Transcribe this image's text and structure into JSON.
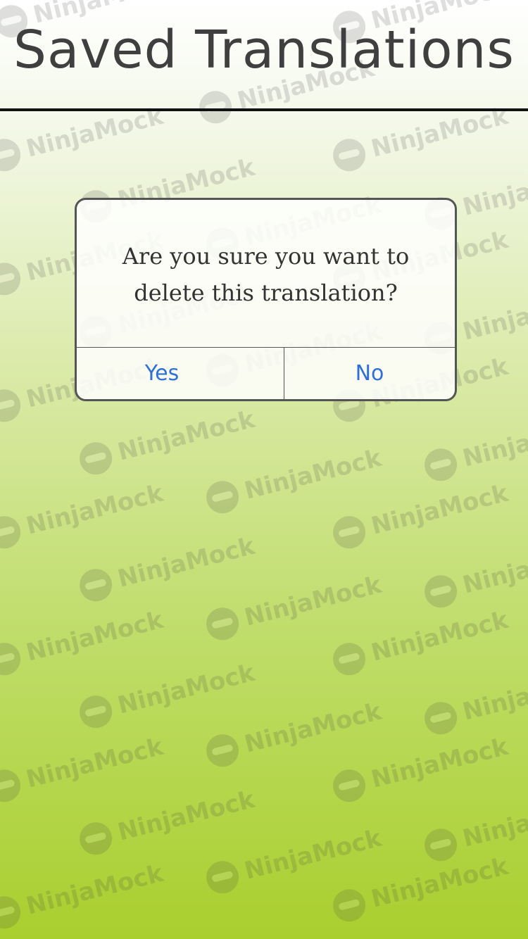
{
  "header": {
    "title": "Saved Translations"
  },
  "dialog": {
    "message": "Are you sure you want to delete this translation?",
    "yes_label": "Yes",
    "no_label": "No"
  },
  "watermark": {
    "text": "NinjaMock",
    "icon": "ninja-icon"
  },
  "colors": {
    "button_text": "#2f6fd8",
    "title_text": "#3f3f3f",
    "gradient_bottom": "#a9cf2e"
  }
}
